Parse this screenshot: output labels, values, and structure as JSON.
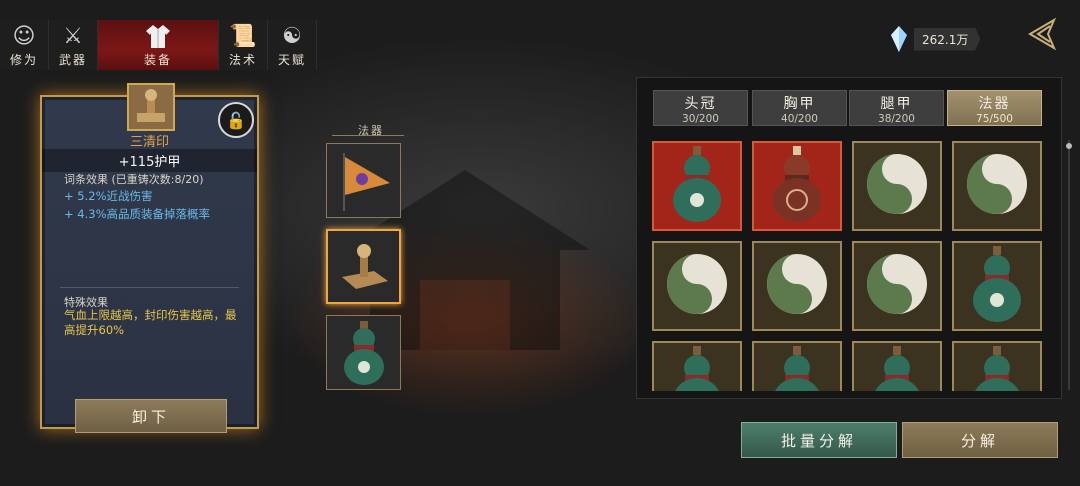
{
  "top_tabs": [
    {
      "label": "修为",
      "icon": "monk-head-icon"
    },
    {
      "label": "武器",
      "icon": "sword-icon"
    },
    {
      "label": "装备",
      "icon": "robe-icon",
      "active": true
    },
    {
      "label": "法术",
      "icon": "scroll-icon"
    },
    {
      "label": "天赋",
      "icon": "taiji-icon"
    }
  ],
  "currency": {
    "amount": "262.1万",
    "icon": "crystal-icon"
  },
  "detail": {
    "name": "三清印",
    "stat_prefix": "+",
    "stat_value": "115",
    "stat_label": "护甲",
    "affix_header": "词条效果 (已重铸次数:8/20)",
    "affixes": [
      "+ 5.2%近战伤害",
      "+ 4.3%高品质装备掉落概率"
    ],
    "special_header": "特殊效果",
    "special_text": "气血上限越高，封印伤害越高，最高提升",
    "special_pct": "60%",
    "unequip_label": "卸下"
  },
  "slots": {
    "column_label": "法器",
    "items": [
      {
        "name": "pennant-flag",
        "selected": false
      },
      {
        "name": "seal-stamp",
        "selected": true
      },
      {
        "name": "gourd",
        "selected": false
      }
    ]
  },
  "inventory": {
    "tabs": [
      {
        "label": "头冠",
        "count": "30/200",
        "active": false
      },
      {
        "label": "胸甲",
        "count": "40/200",
        "active": false
      },
      {
        "label": "腿甲",
        "count": "38/200",
        "active": false
      },
      {
        "label": "法器",
        "count": "75/500",
        "active": true
      }
    ],
    "items": [
      {
        "type": "gourd",
        "rarity": "red"
      },
      {
        "type": "red-gourd",
        "rarity": "red"
      },
      {
        "type": "taiji",
        "rarity": "gold"
      },
      {
        "type": "taiji",
        "rarity": "gold"
      },
      {
        "type": "taiji",
        "rarity": "gold"
      },
      {
        "type": "taiji",
        "rarity": "gold"
      },
      {
        "type": "taiji",
        "rarity": "gold"
      },
      {
        "type": "gourd",
        "rarity": "gold"
      },
      {
        "type": "gourd",
        "rarity": "gold"
      },
      {
        "type": "gourd",
        "rarity": "gold"
      },
      {
        "type": "gourd",
        "rarity": "gold"
      },
      {
        "type": "gourd",
        "rarity": "gold"
      }
    ]
  },
  "actions": {
    "bulk_disassemble": "批量分解",
    "disassemble": "分解"
  },
  "colors": {
    "accent_gold": "#c29a4a",
    "rare_red": "#a32418",
    "affix_blue": "#68b9e8",
    "special_yellow": "#e7c64c"
  }
}
